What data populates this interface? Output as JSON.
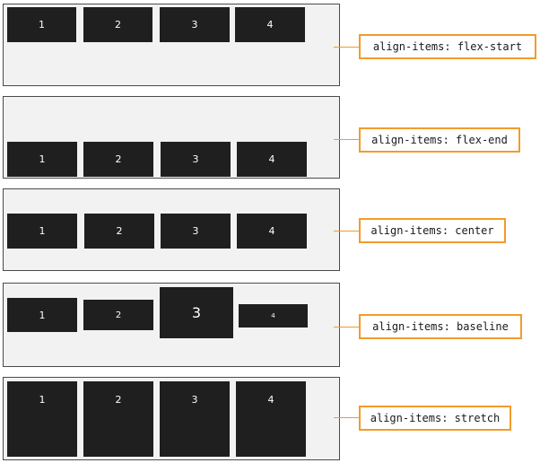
{
  "colors": {
    "panel_bg": "#f1f2f1",
    "panel_border": "#4a4a4a",
    "item_bg": "#1f1f1f",
    "item_text": "#ffffff",
    "accent": "#f29b2c"
  },
  "rows": [
    {
      "label": "align-items: flex-start",
      "items": [
        "1",
        "2",
        "3",
        "4"
      ]
    },
    {
      "label": "align-items: flex-end",
      "items": [
        "1",
        "2",
        "3",
        "4"
      ]
    },
    {
      "label": "align-items: center",
      "items": [
        "1",
        "2",
        "3",
        "4"
      ]
    },
    {
      "label": "align-items: baseline",
      "items": [
        "1",
        "2",
        "3",
        "4"
      ]
    },
    {
      "label": "align-items: stretch",
      "items": [
        "1",
        "2",
        "3",
        "4"
      ]
    }
  ]
}
